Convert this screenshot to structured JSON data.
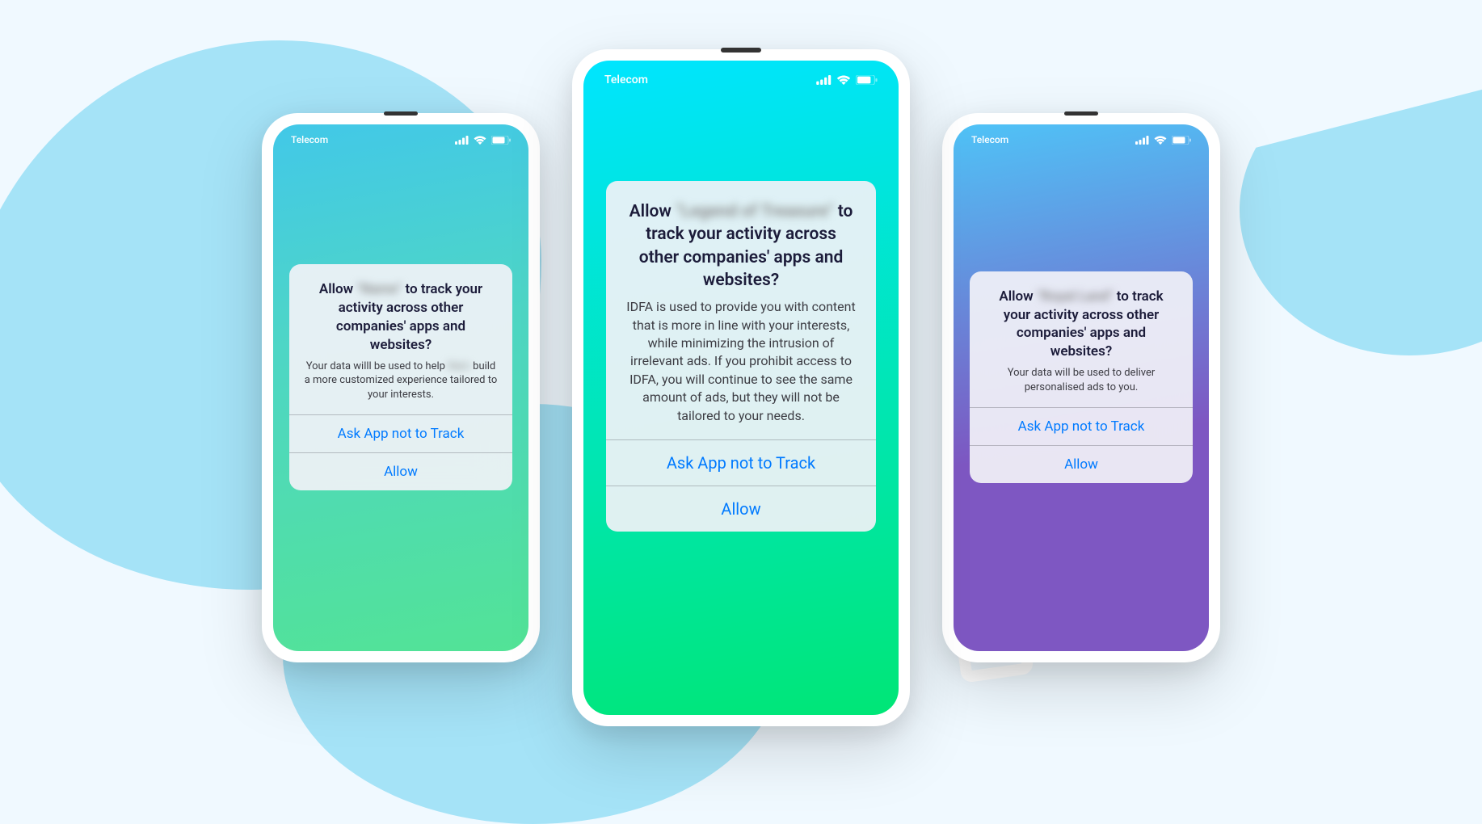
{
  "statusBar": {
    "carrier": "Telecom"
  },
  "phones": [
    {
      "title_prefix": "Allow ",
      "title_blur": "\"Name\"",
      "title_suffix": " to track your activity across other companies' apps and websites?",
      "body_prefix": "Your data willl be used to help ",
      "body_blur": "Nam",
      "body_suffix": " build a more customized experience tailored to your interests.",
      "ask_label": "Ask App not to Track",
      "allow_label": "Allow"
    },
    {
      "title_prefix": "Allow ",
      "title_blur": "\"Legend of Treasure\"",
      "title_suffix": " to track your activity across other companies' apps and websites?",
      "body": "IDFA is used to provide you with content that is more in line with your interests, while minimizing the intrusion of irrelevant ads. If you prohibit access to IDFA, you will continue to see the same amount of ads, but they will not be tailored to your needs.",
      "ask_label": "Ask App not to Track",
      "allow_label": "Allow"
    },
    {
      "title_prefix": "Allow ",
      "title_blur": "\"Royal Land\"",
      "title_suffix": " to track your activity across other companies' apps and websites?",
      "body": "Your data will be used to deliver personalised ads to you.",
      "ask_label": "Ask App not to Track",
      "allow_label": "Allow"
    }
  ]
}
